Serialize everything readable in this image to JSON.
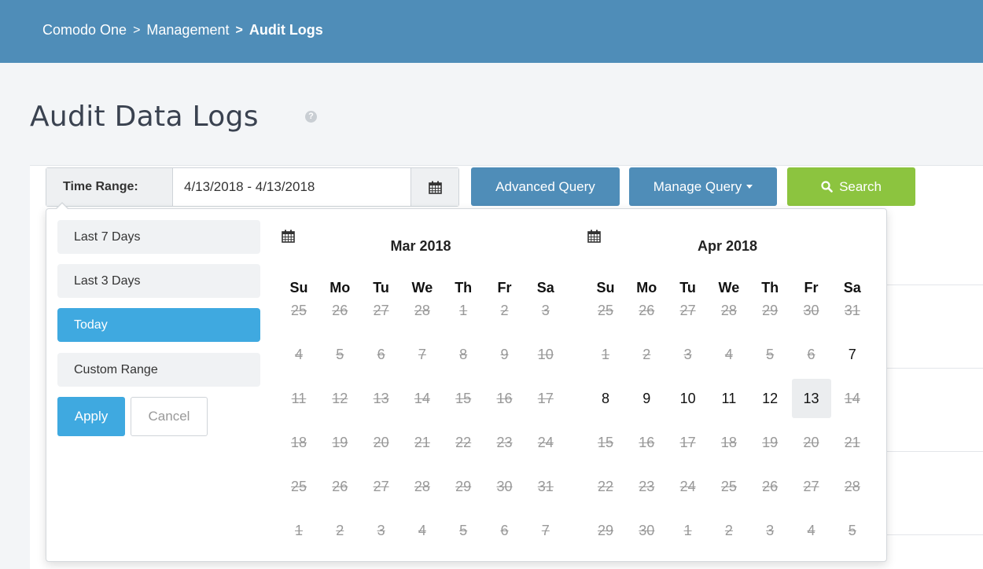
{
  "breadcrumb": {
    "items": [
      "Comodo One",
      "Management",
      "Audit Logs"
    ],
    "separator": ">"
  },
  "page": {
    "title": "Audit Data Logs",
    "help_glyph": "?"
  },
  "toolbar": {
    "time_range_label": "Time Range:",
    "time_range_value": "4/13/2018 - 4/13/2018",
    "advanced_query": "Advanced Query",
    "manage_query": "Manage Query",
    "search": "Search"
  },
  "picker": {
    "ranges": [
      {
        "label": "Last 7 Days",
        "active": false
      },
      {
        "label": "Last 3 Days",
        "active": false
      },
      {
        "label": "Today",
        "active": true
      },
      {
        "label": "Custom Range",
        "active": false
      }
    ],
    "apply": "Apply",
    "cancel": "Cancel",
    "weekdays": [
      "Su",
      "Mo",
      "Tu",
      "We",
      "Th",
      "Fr",
      "Sa"
    ],
    "calendars": [
      {
        "title": "Mar 2018",
        "days": [
          [
            "25",
            "26",
            "27",
            "28",
            "1",
            "2",
            "3"
          ],
          [
            "4",
            "5",
            "6",
            "7",
            "8",
            "9",
            "10"
          ],
          [
            "11",
            "12",
            "13",
            "14",
            "15",
            "16",
            "17"
          ],
          [
            "18",
            "19",
            "20",
            "21",
            "22",
            "23",
            "24"
          ],
          [
            "25",
            "26",
            "27",
            "28",
            "29",
            "30",
            "31"
          ],
          [
            "1",
            "2",
            "3",
            "4",
            "5",
            "6",
            "7"
          ]
        ],
        "available": [],
        "selected": null
      },
      {
        "title": "Apr 2018",
        "days": [
          [
            "25",
            "26",
            "27",
            "28",
            "29",
            "30",
            "31"
          ],
          [
            "1",
            "2",
            "3",
            "4",
            "5",
            "6",
            "7"
          ],
          [
            "8",
            "9",
            "10",
            "11",
            "12",
            "13",
            "14"
          ],
          [
            "15",
            "16",
            "17",
            "18",
            "19",
            "20",
            "21"
          ],
          [
            "22",
            "23",
            "24",
            "25",
            "26",
            "27",
            "28"
          ],
          [
            "29",
            "30",
            "1",
            "2",
            "3",
            "4",
            "5"
          ]
        ],
        "available": [
          [
            1,
            6
          ],
          [
            2,
            0
          ],
          [
            2,
            1
          ],
          [
            2,
            2
          ],
          [
            2,
            3
          ],
          [
            2,
            4
          ],
          [
            2,
            5
          ]
        ],
        "selected": [
          2,
          5
        ]
      }
    ]
  },
  "colors": {
    "header": "#4f8db8",
    "primary": "#4f8db8",
    "search": "#8cc43f",
    "active": "#3fa9e0"
  },
  "icons": {
    "calendar": "calendar-icon",
    "search": "search-icon",
    "dropdown": "caret-down-icon",
    "help": "help-icon"
  }
}
